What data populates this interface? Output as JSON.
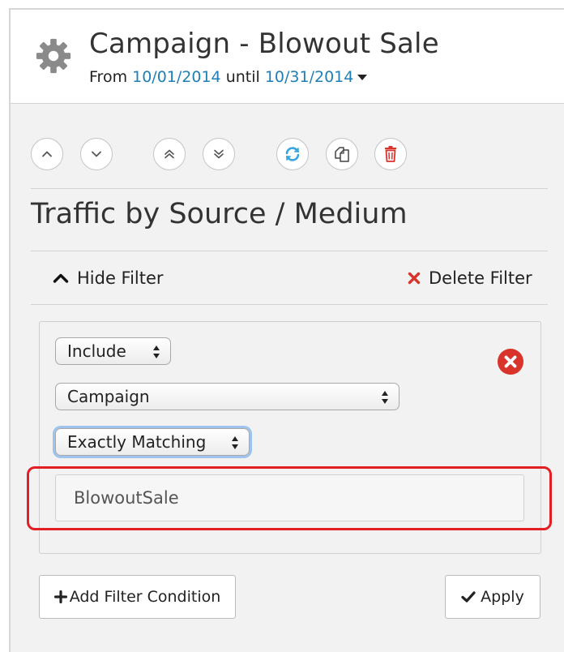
{
  "header": {
    "title": "Campaign - Blowout Sale",
    "date_from_label": "From",
    "date_from": "10/01/2014",
    "date_until_label": "until",
    "date_until": "10/31/2014",
    "settings_icon": "gear-icon"
  },
  "toolbar": {
    "icons": [
      "chevron-up-icon",
      "chevron-down-icon",
      "double-chevron-up-icon",
      "double-chevron-down-icon",
      "refresh-icon",
      "copy-icon",
      "trash-icon"
    ]
  },
  "report": {
    "title": "Traffic by Source / Medium"
  },
  "filter": {
    "hide_label": "Hide Filter",
    "delete_label": "Delete Filter",
    "include_select": "Include",
    "dimension_select": "Campaign",
    "match_select": "Exactly Matching",
    "value": "BlowoutSale",
    "add_condition_label": "Add Filter Condition",
    "apply_label": "Apply"
  },
  "colors": {
    "link_blue": "#1f7fb5",
    "refresh_blue": "#38a6e0",
    "danger_red": "#d9342b",
    "highlight_red": "#e31e24"
  }
}
